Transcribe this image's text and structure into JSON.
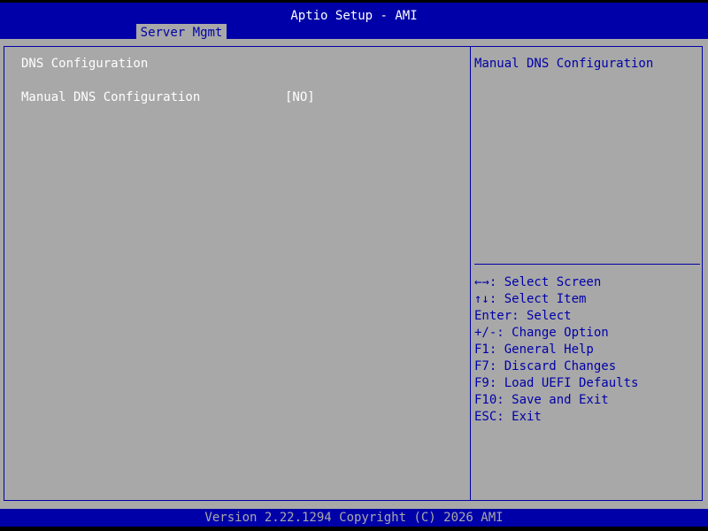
{
  "header": {
    "title": "Aptio Setup - AMI",
    "active_tab": "Server Mgmt"
  },
  "main": {
    "section_heading": "DNS Configuration",
    "settings": [
      {
        "label": "Manual DNS Configuration",
        "value": "[NO]"
      }
    ]
  },
  "help": {
    "description": "Manual DNS Configuration",
    "keys": [
      "←→: Select Screen",
      "↑↓: Select Item",
      "Enter: Select",
      "+/-: Change Option",
      "F1: General Help",
      "F7: Discard Changes",
      "F9: Load UEFI Defaults",
      "F10: Save and Exit",
      "ESC: Exit"
    ]
  },
  "footer": {
    "version_text": "Version 2.22.1294 Copyright (C) 2026 AMI"
  },
  "colors": {
    "bios_blue": "#0000a8",
    "bios_gray": "#a8a8a8",
    "text_white": "#ffffff",
    "background_black": "#000000"
  }
}
